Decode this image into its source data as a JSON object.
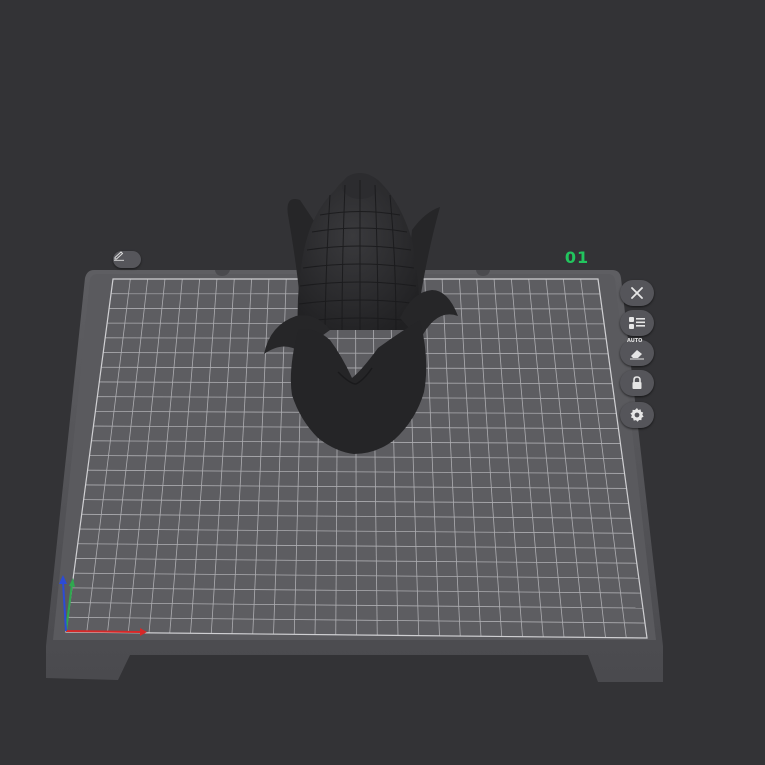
{
  "plate": {
    "number": "01"
  },
  "toolbar": {
    "auto_label": "AUTO",
    "buttons": [
      {
        "name": "close-button",
        "icon": "close-icon"
      },
      {
        "name": "arrange-button",
        "icon": "list-arrange-icon"
      },
      {
        "name": "auto-orient-button",
        "icon": "eraser-auto-icon"
      },
      {
        "name": "lock-button",
        "icon": "lock-icon"
      },
      {
        "name": "settings-button",
        "icon": "gear-icon"
      }
    ]
  },
  "colors": {
    "background": "#333336",
    "plate_number": "#22c55e",
    "x_axis": "#d62828",
    "y_axis": "#2fa84f",
    "z_axis": "#2c4bd6",
    "model": "#2a2a2c"
  }
}
